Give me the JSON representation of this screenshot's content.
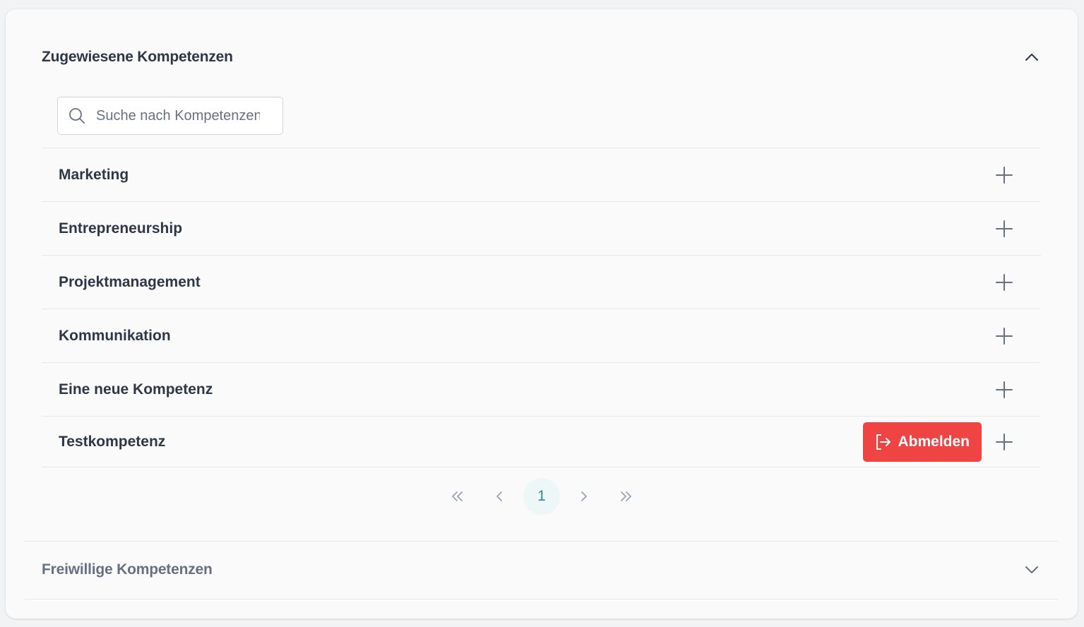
{
  "assigned_section": {
    "title": "Zugewiesene Kompetenzen",
    "toggle_icon": "chevron-up-icon"
  },
  "search": {
    "placeholder": "Suche nach Kompetenzen",
    "icon": "search-icon"
  },
  "competencies": [
    {
      "label": "Marketing"
    },
    {
      "label": "Entrepreneurship"
    },
    {
      "label": "Projektmanagement"
    },
    {
      "label": "Kommunikation"
    },
    {
      "label": "Eine neue Kompetenz"
    },
    {
      "label": "Testkompetenz",
      "action_label": "Abmelden"
    }
  ],
  "pagination": {
    "current_page": "1",
    "icons": [
      "chevrons-left-icon",
      "chevron-left-icon",
      "chevron-right-icon",
      "chevrons-right-icon"
    ]
  },
  "voluntary_section": {
    "title": "Freiwillige Kompetenzen",
    "toggle_icon": "chevron-down-icon"
  },
  "colors": {
    "danger": "#ef4444",
    "accent": "#2d8c8a",
    "text": "#2d3748",
    "muted": "#667085"
  }
}
